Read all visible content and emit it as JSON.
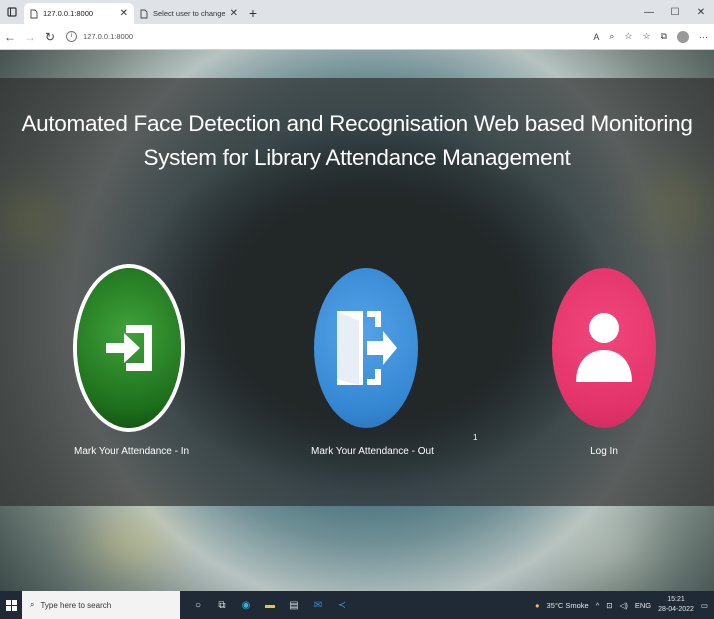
{
  "browser": {
    "tabs": [
      {
        "title": "127.0.0.1:8000",
        "active": true
      },
      {
        "title": "Select user to change | Django s",
        "active": false
      }
    ],
    "url": "127.0.0.1:8000"
  },
  "page": {
    "title": "Automated Face Detection and Recognisation Web based Monitoring System for Library Attendance Management",
    "actions": [
      {
        "label": "Mark Your Attendance - In",
        "icon": "sign-in-icon",
        "color": "#1f7a1f"
      },
      {
        "label": "Mark Your Attendance - Out",
        "icon": "sign-out-icon",
        "color": "#3a8ad6"
      },
      {
        "label": "Log In",
        "icon": "user-icon",
        "color": "#e5386e"
      }
    ],
    "stray_text": "1"
  },
  "taskbar": {
    "search_placeholder": "Type here to search",
    "weather": "35°C  Smoke",
    "lang": "ENG",
    "time": "15:21",
    "date": "28-04-2022"
  }
}
